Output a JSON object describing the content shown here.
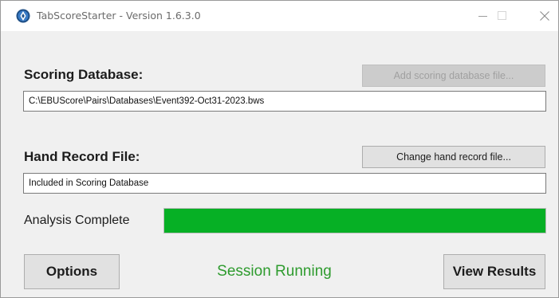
{
  "window": {
    "title": "TabScoreStarter - Version 1.6.3.0"
  },
  "scoring_database": {
    "label": "Scoring Database:",
    "button_label": "Add scoring database file...",
    "path": "C:\\EBUScore\\Pairs\\Databases\\Event392-Oct31-2023.bws"
  },
  "hand_record": {
    "label": "Hand Record File:",
    "button_label": "Change hand record file...",
    "value": "Included in Scoring Database"
  },
  "analysis": {
    "label": "Analysis Complete",
    "progress": 1.0,
    "bar_color": "#06b025"
  },
  "footer": {
    "options_label": "Options",
    "status": "Session Running",
    "view_results_label": "View Results"
  },
  "icons": {
    "app": "app-logo-icon",
    "minimize": "minimize-icon",
    "maximize": "maximize-icon",
    "close": "close-icon"
  }
}
